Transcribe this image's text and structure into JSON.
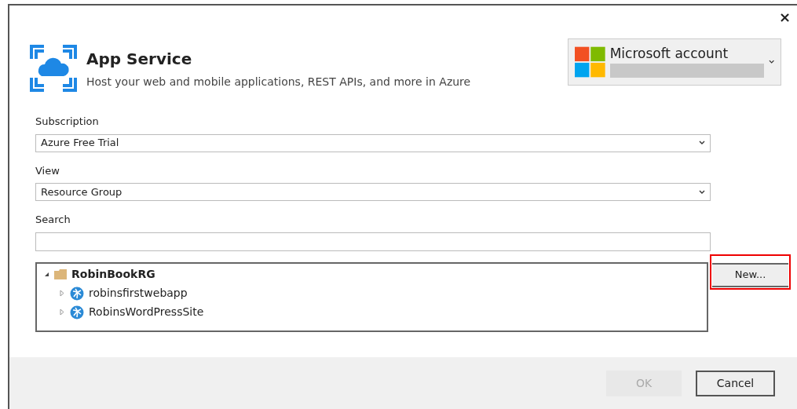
{
  "window": {
    "close": "×"
  },
  "header": {
    "title": "App Service",
    "subtitle": "Host your web and mobile applications, REST APIs, and more in Azure"
  },
  "account": {
    "label": "Microsoft account"
  },
  "subscription": {
    "label": "Subscription",
    "value": "Azure Free Trial"
  },
  "view": {
    "label": "View",
    "value": "Resource Group"
  },
  "search": {
    "label": "Search"
  },
  "tree": [
    {
      "label": "RobinBookRG",
      "kind": "group",
      "expanded": true,
      "children": [
        {
          "label": "robinsfirstwebapp",
          "kind": "app",
          "expanded": false
        },
        {
          "label": "RobinsWordPressSite",
          "kind": "app",
          "expanded": false
        }
      ]
    }
  ],
  "new_button": {
    "label": "New...",
    "highlighted": true
  },
  "buttons": [
    {
      "label": "OK",
      "disabled": true
    },
    {
      "label": "Cancel",
      "disabled": false
    }
  ]
}
